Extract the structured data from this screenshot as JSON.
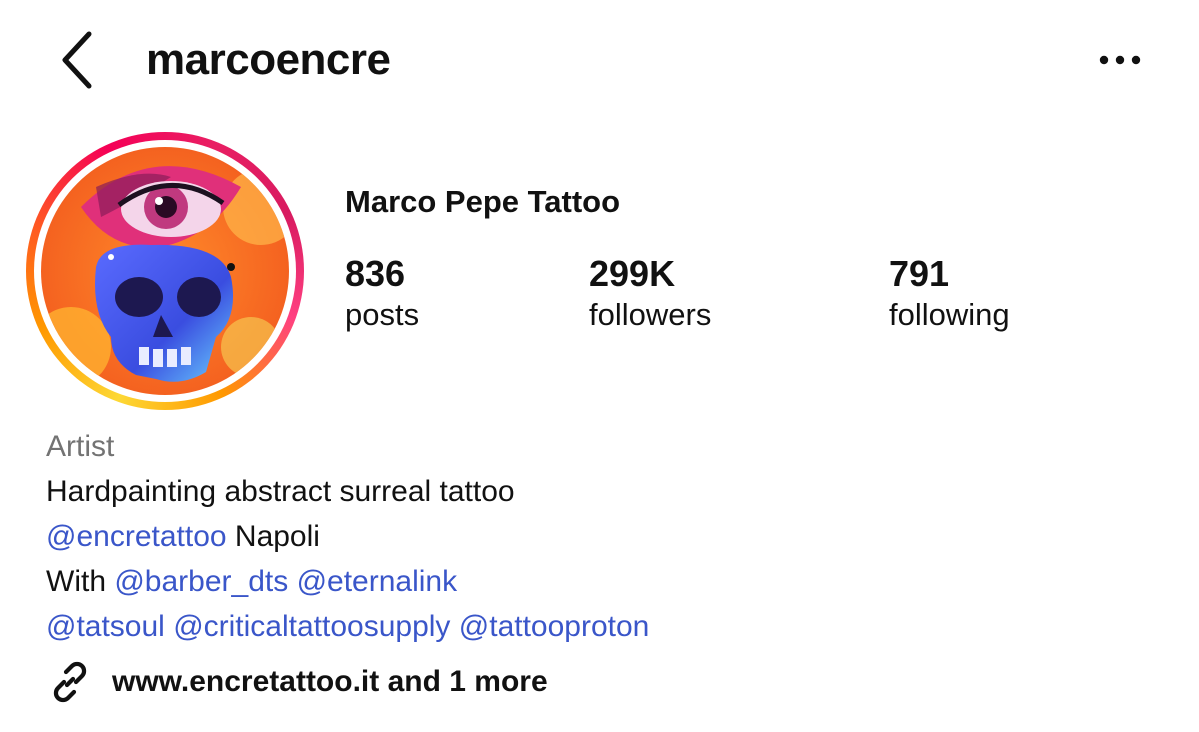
{
  "header": {
    "username": "marcoencre",
    "back_icon": "chevron-left-icon",
    "more_icon": "more-horizontal-icon"
  },
  "profile": {
    "display_name": "Marco Pepe Tattoo",
    "avatar": "avatar-artwork-skull-eye",
    "stats": {
      "posts": {
        "count": "836",
        "label": "posts"
      },
      "followers": {
        "count": "299K",
        "label": "followers"
      },
      "following": {
        "count": "791",
        "label": "following"
      }
    }
  },
  "bio": {
    "category": "Artist",
    "line1": "Hardpainting abstract surreal tattoo",
    "line2": {
      "mention": "@encretattoo",
      "text": " Napoli"
    },
    "line3": {
      "prefix": "With ",
      "mention1": "@barber_dts",
      "mention2": "@eternalink"
    },
    "line4": {
      "mention1": "@tatsoul",
      "mention2": "@criticaltattoosupply",
      "mention3": "@tattooproton"
    }
  },
  "link": {
    "icon": "link-icon",
    "text": "www.encretattoo.it and 1 more"
  },
  "colors": {
    "mention": "#3a56c9",
    "category": "#737373",
    "text": "#111111"
  }
}
